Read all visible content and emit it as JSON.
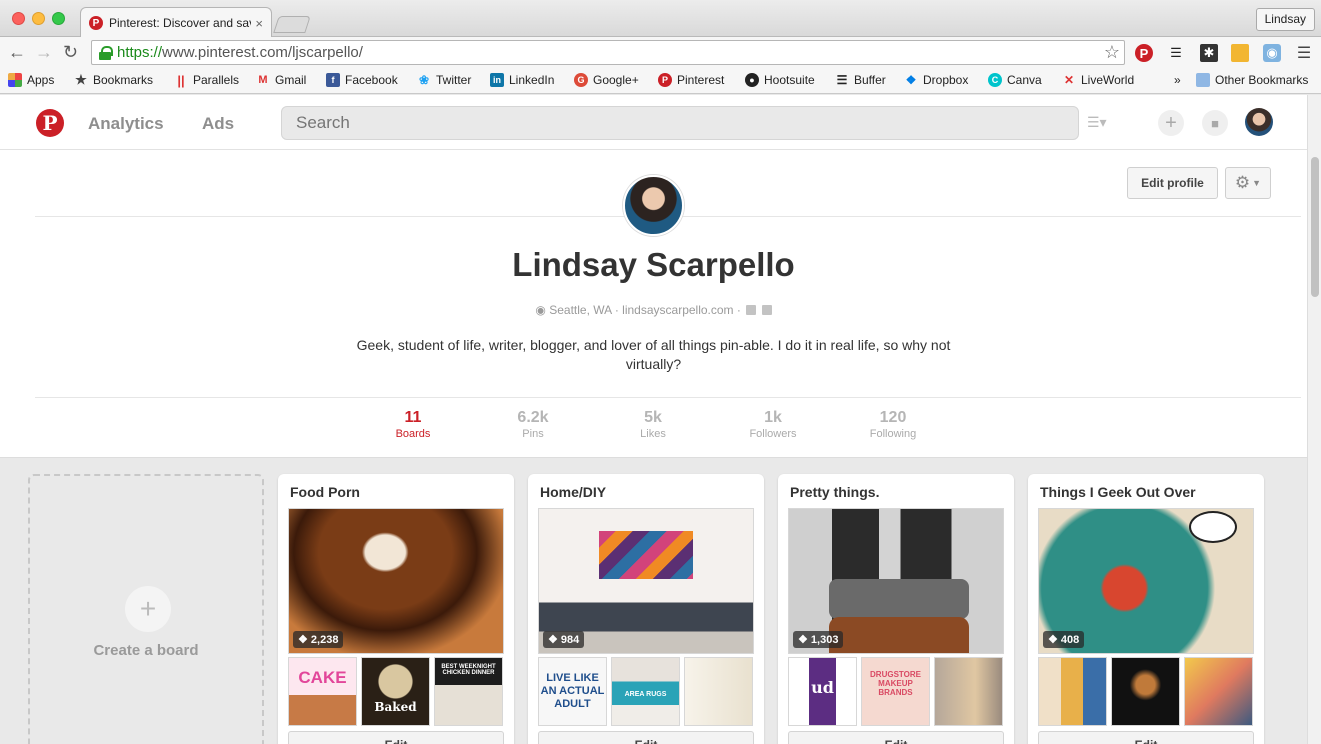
{
  "browser": {
    "tab_title": "Pinterest: Discover and save creative ideas",
    "tab_close": "×",
    "profile_button": "Lindsay",
    "url_secure": "https://",
    "url_rest": "www.pinterest.com/ljscarpello/",
    "bookmarks": [
      "Apps",
      "Bookmarks",
      "Parallels",
      "Gmail",
      "Facebook",
      "Twitter",
      "LinkedIn",
      "Google+",
      "Pinterest",
      "Hootsuite",
      "Buffer",
      "Dropbox",
      "Canva",
      "LiveWorld"
    ],
    "overflow": "»",
    "other_bookmarks": "Other Bookmarks"
  },
  "header": {
    "nav": [
      "Analytics",
      "Ads"
    ],
    "search_placeholder": "Search"
  },
  "profile": {
    "edit_button": "Edit profile",
    "name": "Lindsay Scarpello",
    "location": "Seattle, WA",
    "separator": "·",
    "website": "lindsayscarpello.com",
    "bio": "Geek, student of life, writer, blogger, and lover of all things pin-able. I do it in real life, so why not virtually?",
    "stats": [
      {
        "value": "11",
        "label": "Boards"
      },
      {
        "value": "6.2k",
        "label": "Pins"
      },
      {
        "value": "5k",
        "label": "Likes"
      },
      {
        "value": "1k",
        "label": "Followers"
      },
      {
        "value": "120",
        "label": "Following"
      }
    ]
  },
  "create_board_label": "Create a board",
  "boards": [
    {
      "title": "Food Porn",
      "pins": "2,238",
      "edit": "Edit",
      "thumbs": [
        "CAKE",
        "Baked",
        "BEST WEEKNIGHT CHICKEN DINNER"
      ]
    },
    {
      "title": "Home/DIY",
      "pins": "984",
      "edit": "Edit",
      "thumbs": [
        "LIVE LIKE AN ACTUAL ADULT",
        "AREA RUGS",
        ""
      ]
    },
    {
      "title": "Pretty things.",
      "pins": "1,303",
      "edit": "Edit",
      "thumbs": [
        "ud",
        "DRUGSTORE MAKEUP BRANDS",
        ""
      ]
    },
    {
      "title": "Things I Geek Out Over",
      "pins": "408",
      "edit": "Edit",
      "thumbs": [
        "",
        "",
        ""
      ]
    }
  ],
  "colors": {
    "brand": "#cb2027",
    "page_bg": "#e9e9e9"
  }
}
